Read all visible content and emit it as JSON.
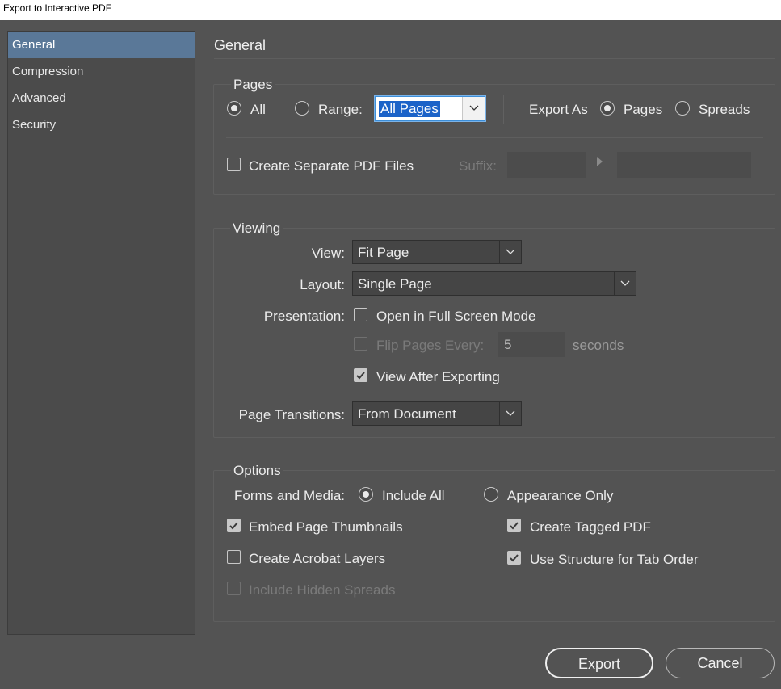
{
  "window": {
    "title": "Export to Interactive PDF"
  },
  "sidebar": {
    "items": [
      {
        "label": "General",
        "active": true
      },
      {
        "label": "Compression",
        "active": false
      },
      {
        "label": "Advanced",
        "active": false
      },
      {
        "label": "Security",
        "active": false
      }
    ]
  },
  "main": {
    "title": "General"
  },
  "pages": {
    "group_label": "Pages",
    "all_label": "All",
    "all_selected": true,
    "range_label": "Range:",
    "range_value": "All Pages",
    "export_as_label": "Export As",
    "export_as_pages_label": "Pages",
    "export_as_spreads_label": "Spreads",
    "export_as_selected": "Pages",
    "separate_files_label": "Create Separate PDF Files",
    "separate_files_checked": false,
    "suffix_label": "Suffix:",
    "suffix_value": ""
  },
  "viewing": {
    "group_label": "Viewing",
    "view_label": "View:",
    "view_value": "Fit Page",
    "layout_label": "Layout:",
    "layout_value": "Single Page",
    "presentation_label": "Presentation:",
    "full_screen_label": "Open in Full Screen Mode",
    "full_screen_checked": false,
    "flip_pages_label": "Flip Pages Every:",
    "flip_pages_value": "5",
    "flip_pages_unit": "seconds",
    "flip_pages_checked": false,
    "view_after_label": "View After Exporting",
    "view_after_checked": true,
    "transitions_label": "Page Transitions:",
    "transitions_value": "From Document"
  },
  "options": {
    "group_label": "Options",
    "forms_media_label": "Forms and Media:",
    "include_all_label": "Include All",
    "appearance_only_label": "Appearance Only",
    "forms_media_selected": "Include All",
    "embed_thumbnails_label": "Embed Page Thumbnails",
    "embed_thumbnails_checked": true,
    "tagged_pdf_label": "Create Tagged PDF",
    "tagged_pdf_checked": true,
    "acrobat_layers_label": "Create Acrobat Layers",
    "acrobat_layers_checked": false,
    "tab_order_label": "Use Structure for Tab Order",
    "tab_order_checked": true,
    "hidden_spreads_label": "Include Hidden Spreads",
    "hidden_spreads_checked": false
  },
  "buttons": {
    "export": "Export",
    "cancel": "Cancel"
  },
  "colors": {
    "accent": "#5a7898",
    "panel": "#535353",
    "selection": "#1c63c8"
  }
}
